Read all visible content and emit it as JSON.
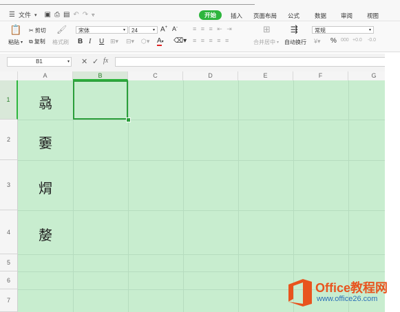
{
  "menubar": {
    "file_label": "文件",
    "tabs": [
      "开始",
      "插入",
      "页面布局",
      "公式",
      "数据",
      "审阅",
      "视图"
    ],
    "active_tab": "开始"
  },
  "ribbon": {
    "paste": "粘贴",
    "cut": "剪切",
    "copy": "复制",
    "format_painter": "格式刷",
    "font_name": "宋体",
    "font_size": "24",
    "bold": "B",
    "italic": "I",
    "underline": "U",
    "merge_center": "合并居中",
    "wrap_text": "自动换行",
    "number_format": "常规",
    "percent": "%",
    "comma": "000",
    "inc_decimal": "+0.0",
    "dec_decimal": "-0.0"
  },
  "formula_bar": {
    "name_box": "B1",
    "fx": "fx",
    "value": ""
  },
  "sheet": {
    "columns": [
      "A",
      "B",
      "C",
      "D",
      "E",
      "F",
      "G"
    ],
    "rows": [
      "1",
      "2",
      "3",
      "4",
      "5",
      "6",
      "7"
    ],
    "selected_cell": "B1",
    "cells_a": [
      "骉",
      "嫑",
      "焨",
      "嫠"
    ],
    "background_color": "#c8edcf",
    "accent_color": "#2db53d"
  },
  "watermark": {
    "brand": "Office教程网",
    "url": "www.office26.com"
  }
}
